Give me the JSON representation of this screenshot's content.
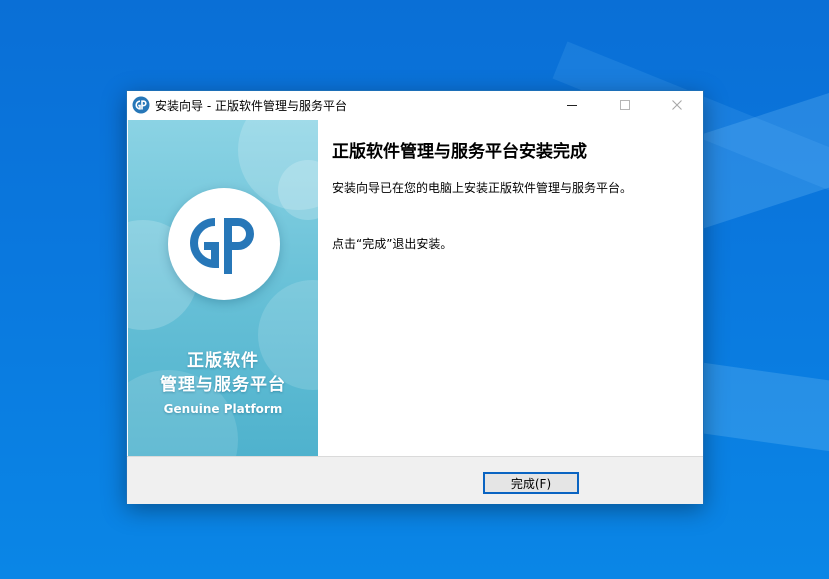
{
  "window": {
    "title": "安装向导 - 正版软件管理与服务平台",
    "controls": {
      "minimize": "─",
      "maximize": "☐",
      "close": "✕"
    }
  },
  "side_panel": {
    "logo_icon": "gp-logo-icon",
    "title_line1": "正版软件",
    "title_line2": "管理与服务平台",
    "subtitle": "Genuine Platform"
  },
  "content": {
    "heading": "正版软件管理与服务平台安装完成",
    "description": "安装向导已在您的电脑上安装正版软件管理与服务平台。",
    "hint": "点击“完成”退出安装。"
  },
  "footer": {
    "finish_label": "完成(F)"
  },
  "colors": {
    "desktop": "#0a78de",
    "panel_top": "#8bd3e4",
    "panel_bottom": "#4fb2cd",
    "logo_blue": "#2777b8",
    "button_border": "#0a64c2"
  }
}
